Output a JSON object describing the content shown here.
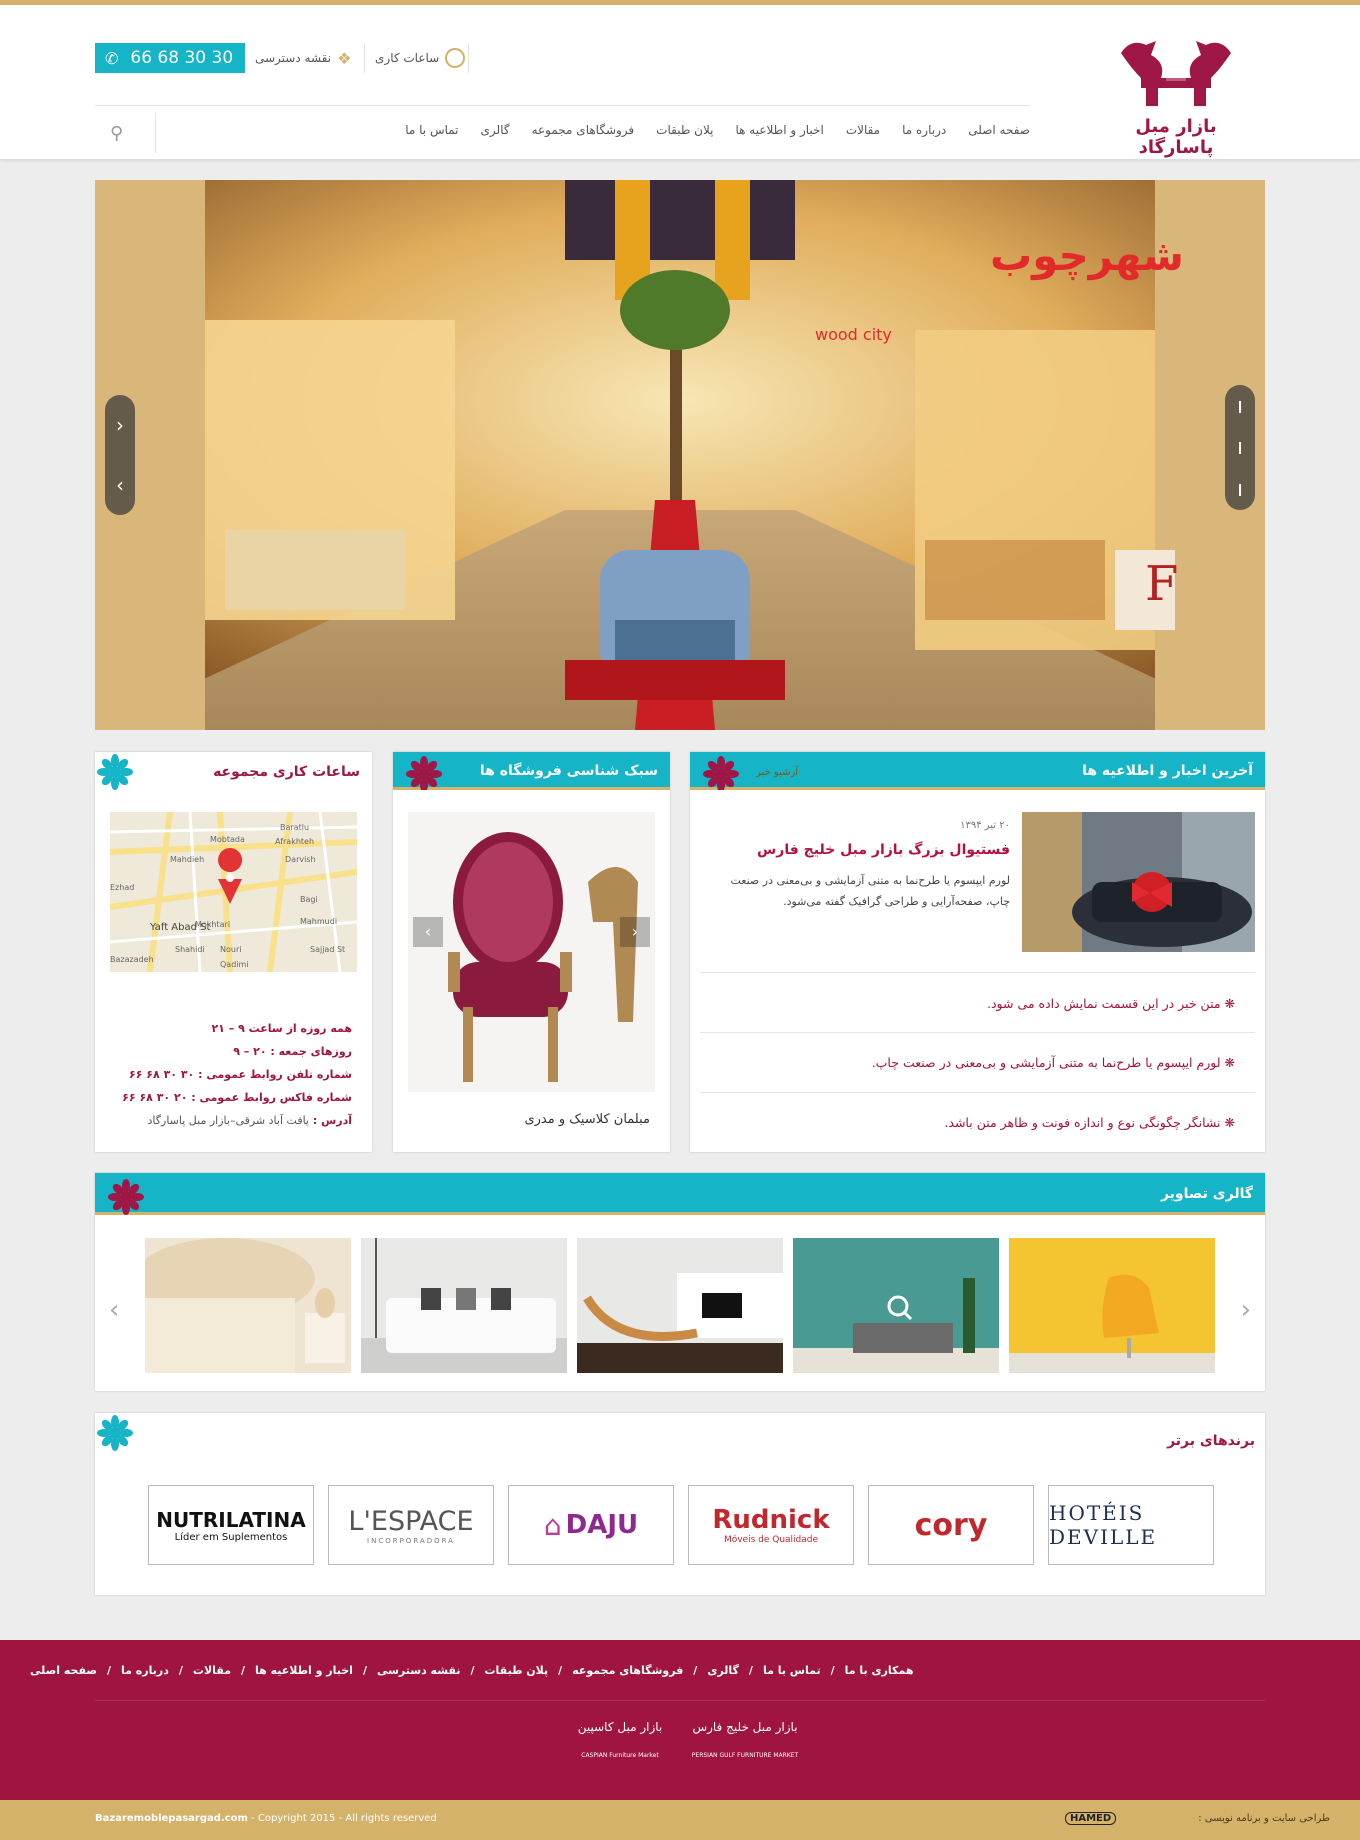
{
  "header": {
    "phone": "66 68 30 30",
    "hours_link": "ساعات کاری",
    "map_link": "نقشه دسترسی",
    "logo_text": "بازار مبل پاسارگاد",
    "nav": [
      "صفحه اصلی",
      "درباره ما",
      "مقالات",
      "اخبار و اطلاعیه ها",
      "پلان طبقات",
      "فروشگاهای مجموعه",
      "گالری",
      "تماس با ما"
    ]
  },
  "slider": {
    "store_sign": "شهرچوب",
    "store_sign2": "wood city",
    "store_letter": "F"
  },
  "news": {
    "title": "آخرین اخبار و اطلاعیه ها",
    "archive": "آرشیو خبر",
    "featured_date": "۲۰ تیر ۱۳۹۴",
    "featured_title": "فستیوال بزرگ بازار مبل خلیج فارس",
    "featured_text": "لورم ایپسوم یا طرح‌نما  به متنی آزمایشی و بی‌معنی در صنعت چاپ، صفحه‌آرایی و طراحی گرافیک گفته می‌شود.",
    "items": [
      "متن خبر در این قسمت نمایش داده می شود.",
      "لورم ایپسوم یا طرح‌نما به متنی آزمایشی و بی‌معنی در صنعت چاپ.",
      "نشانگر چگونگی نوع و اندازه فونت و ظاهر متن باشد."
    ]
  },
  "style": {
    "title": "سبک شناسی فروشگاه ها",
    "caption": "مبلمان کلاسیک و مدری"
  },
  "hours": {
    "title": "ساعات کاری مجموعه",
    "map_labels": [
      "Baratlu",
      "Mobtada",
      "Afrakhteh",
      "Mahdieh",
      "Darvish",
      "Ezhad",
      "Yaft Abad St",
      "Bagi",
      "Mahmudi",
      "Mokhtari",
      "Sajjad St",
      "Nouri",
      "Qadimi",
      "Shahidi",
      "Bazazadeh"
    ],
    "lines": [
      "همه روزه از ساعت ۹ – ۲۱",
      "روزهای جمعه : ۲۰ – ۹",
      "شماره تلفن روابط عمومی : ۳۰ ۳۰ ۶۸ ۶۶",
      "شماره فاکس روابط عمومی : ۲۰ ۳۰ ۶۸ ۶۶"
    ],
    "address_label": "آدرس :",
    "address": "یافت آباد شرقی–بازار مبل پاسارگاد"
  },
  "gallery": {
    "title": "گالری تصاویر"
  },
  "brands": {
    "title": "برندهای برتر",
    "items": [
      {
        "name": "HOTÉIS DEVILLE",
        "color": "#1d2f4e"
      },
      {
        "name": "cory",
        "color": "#c1282d"
      },
      {
        "name": "Rudnick",
        "sub": "Móveis de Qualidade",
        "color": "#c1282d"
      },
      {
        "name": "DAJU",
        "color": "#8e2a8f"
      },
      {
        "name": "L'ESPACE",
        "sub": "INCORPORADORA",
        "color": "#555555"
      },
      {
        "name": "NUTRILATINA",
        "sub": "Líder em Suplementos",
        "color": "#111111"
      }
    ]
  },
  "footer": {
    "nav": [
      "صفحه اصلی",
      "درباره ما",
      "مقالات",
      "اخبار و اطلاعیه ها",
      "نقشه دسترسی",
      "پلان طبقات",
      "فروشگاهای مجموعه",
      "گالری",
      "تماس با ما",
      "همکاری با ما"
    ],
    "logo1": "بازار مبل خلیج فارس",
    "logo1_sub": "PERSIAN GULF FURNITURE MARKET",
    "logo2": "بازار مبل کاسپین",
    "logo2_sub": "CASPIAN Furniture Market",
    "site": "Bazaremoblepasargad.com",
    "copyright": " - Copyright 2015 - All rights reserved",
    "designer_label": "طراحی سایت و برنامه نویسی :",
    "designer": "HAMED"
  },
  "colors": {
    "teal": "#15b4c6",
    "maroon": "#9e1746",
    "gold": "#d4b26a"
  }
}
